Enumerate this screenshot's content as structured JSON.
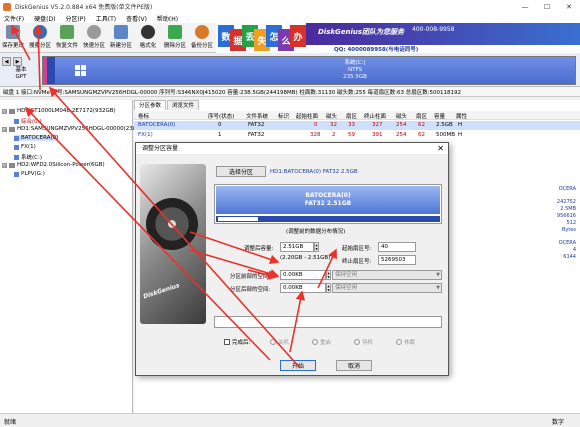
{
  "window": {
    "title": "DiskGenius V5.2.0.884 x64 免费版(单文件PE版)",
    "controls": [
      "—",
      "☐",
      "✕"
    ]
  },
  "menu": [
    "文件(F)",
    "硬盘(D)",
    "分区(P)",
    "工具(T)",
    "查看(V)",
    "帮助(H)"
  ],
  "toolbar": [
    {
      "label": "保存更改",
      "icon": "save-icon",
      "color": "#7a8aa8"
    },
    {
      "label": "搜索分区",
      "icon": "search-icon",
      "color": "#3b6bb0"
    },
    {
      "label": "恢复文件",
      "icon": "recover-icon",
      "color": "#5aa25a"
    },
    {
      "label": "快速分区",
      "icon": "quick-partition-icon",
      "color": "#9a9a9a"
    },
    {
      "label": "新建分区",
      "icon": "new-partition-icon",
      "color": "#5c86c8"
    },
    {
      "label": "格式化",
      "icon": "format-icon",
      "color": "#333333"
    },
    {
      "label": "删除分区",
      "icon": "delete-icon",
      "color": "#3aa84e"
    },
    {
      "label": "备份分区",
      "icon": "backup-icon",
      "color": "#d97a2a"
    }
  ],
  "banner": {
    "chars": [
      "数",
      "据",
      "丢",
      "失",
      "怎",
      "么",
      "办"
    ],
    "char_colors": [
      "#2b6fd6",
      "#d6322b",
      "#28a04a",
      "#f0a020",
      "#2b6fd6",
      "#7a3ab0",
      "#d6322b"
    ],
    "slogan": "DiskGenius团队为您服务",
    "phone": "400-008-9958",
    "qq": "QQ: 4000089958(与电话同号)"
  },
  "diskmap": {
    "nav": [
      "◀",
      "▶"
    ],
    "basic_label": "基本",
    "basic_type": "GPT",
    "partition_name": "系统(C:)",
    "fs": "NTFS",
    "size": "235.5GB"
  },
  "disk_info": "磁盘 1 接口:NVMe  型号:SAMSUNGMZVPV256HDGL-00000  序列号:S346NX0J415020  容量:238.5GB(244198MB)  柱面数:31130  磁头数:255  每道扇区数:63  总扇区数:500118192",
  "tree": [
    {
      "text": "HD0:ST1000LM048-2E7172(932GB)",
      "type": "disk",
      "toggle": "⊟"
    },
    {
      "text": "综合(0:)",
      "type": "part",
      "red": true
    },
    {
      "text": "HD1:SAMSUNGMZVPV256HDGL-00000(238GB)",
      "type": "disk",
      "toggle": "⊟"
    },
    {
      "text": "BATOCERA(0)",
      "type": "part",
      "selected": true
    },
    {
      "text": "FX(1)",
      "type": "part"
    },
    {
      "text": "系统(C:)",
      "type": "part"
    },
    {
      "text": "HD2:WFD2.0Silicon-Power(6GB)",
      "type": "disk",
      "toggle": "⊟"
    },
    {
      "text": "PLPV(G:)",
      "type": "part"
    }
  ],
  "tabs": [
    "分区参数",
    "浏览文件"
  ],
  "partition_table": {
    "headers": [
      "卷标",
      "序号(状态)",
      "文件系统",
      "标识",
      "起始柱面",
      "磁头",
      "扇区",
      "终止柱面",
      "磁头",
      "扇区",
      "容量",
      "属性"
    ],
    "rows": [
      [
        "BATOCERA(0)",
        "0",
        "FAT32",
        "",
        "0",
        "32",
        "33",
        "327",
        "254",
        "62",
        "2.5GB",
        "H"
      ],
      [
        "FX(1)",
        "1",
        "FAT32",
        "",
        "328",
        "2",
        "59",
        "391",
        "254",
        "62",
        "500MB",
        "H"
      ]
    ]
  },
  "side_fragments": [
    "OCERA",
    "242752",
    "2.5MB",
    "956616",
    "512",
    "Bytes",
    "OCERA",
    "4",
    "6144"
  ],
  "status": {
    "left": "就绪",
    "right": "数字"
  },
  "dialog": {
    "title": "调整分区容量",
    "select_button": "选择分区",
    "partition_info": "HD1:BATOCERA(0)  FAT32  2.5GB",
    "visual_name": "BATOCERA(0)",
    "visual_detail": "FAT32 2.51GB",
    "caption": "(调整前的数据分布情况)",
    "hdd_brand": "DiskGenius",
    "size_label": "调整后容量:",
    "size_value": "2.51GB",
    "range_text": "(2.20GB - 2.51GB)",
    "start_label": "起始扇区号:",
    "start_value": "40",
    "end_label": "终止扇区号:",
    "end_value": "5269503",
    "before_label": "分区前部的空间:",
    "before_value": "0.00KB",
    "after_label": "分区后部的空间:",
    "after_value": "0.00KB",
    "keep_free_1": "保持空闲",
    "keep_free_2": "保持空闲",
    "finish_label": "完成后:",
    "options": [
      "关机",
      "重启",
      "待机",
      "休眠"
    ],
    "start_button": "开始",
    "cancel_button": "取消",
    "close": "✕"
  },
  "annotation_color": "#e8322a"
}
